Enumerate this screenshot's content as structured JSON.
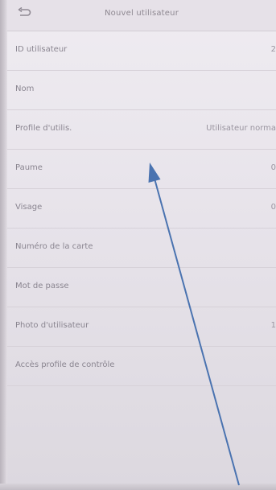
{
  "header": {
    "title": "Nouvel utilisateur",
    "back_icon": "back-arrow-icon"
  },
  "rows": [
    {
      "label": "ID utilisateur",
      "value": "2"
    },
    {
      "label": "Nom",
      "value": ""
    },
    {
      "label": "Profile d'utilis.",
      "value": "Utilisateur norma"
    },
    {
      "label": "Paume",
      "value": "0"
    },
    {
      "label": "Visage",
      "value": "0"
    },
    {
      "label": "Numéro de la carte",
      "value": ""
    },
    {
      "label": "Mot de passe",
      "value": ""
    },
    {
      "label": "Photo d'utilisateur",
      "value": "1"
    },
    {
      "label": "Accès profile de contrôle",
      "value": ""
    }
  ],
  "annotation": {
    "color": "#4a73b0",
    "icon": "pointer-arrow"
  }
}
